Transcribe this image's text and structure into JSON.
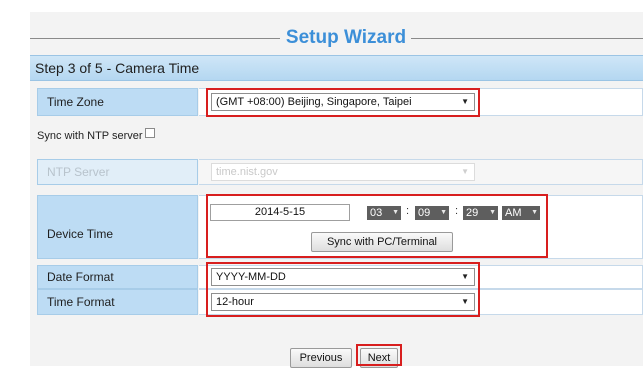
{
  "wizard": {
    "title": "Setup Wizard",
    "step": "Step 3 of 5 - Camera Time"
  },
  "time_zone": {
    "label": "Time Zone",
    "value": "(GMT +08:00) Beijing, Singapore, Taipei"
  },
  "ntp": {
    "sync_label": "Sync with NTP server",
    "sync_checked": false,
    "server_label": "NTP Server",
    "server_value": "time.nist.gov"
  },
  "device_time": {
    "label": "Device Time",
    "date": "2014-5-15",
    "hour": "03",
    "minute": "09",
    "second": "29",
    "ampm": "AM",
    "sync_button": "Sync  with  PC/Terminal"
  },
  "date_format": {
    "label": "Date Format",
    "value": "YYYY-MM-DD"
  },
  "time_format": {
    "label": "Time Format",
    "value": "12-hour"
  },
  "buttons": {
    "previous": "Previous",
    "next": "Next"
  },
  "colors": {
    "title_blue": "#3c8fd8",
    "highlight_red": "#d81e1e",
    "label_blue": "#bddcf4"
  }
}
